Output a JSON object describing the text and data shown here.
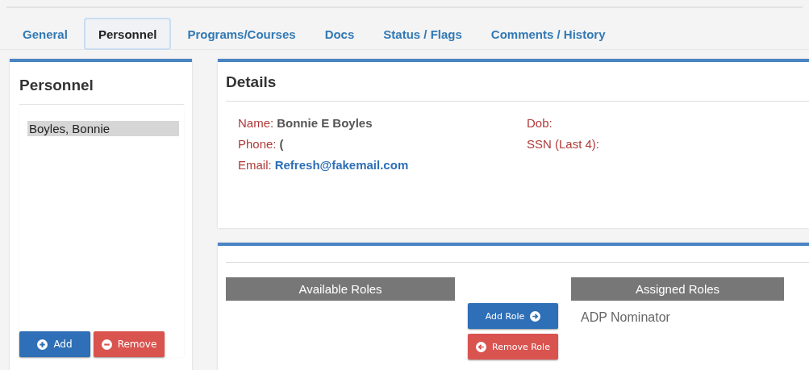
{
  "tabs": [
    {
      "label": "General",
      "selected": false
    },
    {
      "label": "Personnel",
      "selected": true
    },
    {
      "label": "Programs/Courses",
      "selected": false
    },
    {
      "label": "Docs",
      "selected": false
    },
    {
      "label": "Status / Flags",
      "selected": false
    },
    {
      "label": "Comments / History",
      "selected": false
    }
  ],
  "personnel": {
    "title": "Personnel",
    "items": [
      {
        "name": "Boyles, Bonnie",
        "selected": true
      }
    ],
    "buttons": [
      {
        "label": "Add",
        "kind": "add"
      },
      {
        "label": "Remove",
        "kind": "remove"
      }
    ]
  },
  "details": {
    "title": "Details",
    "fields": [
      {
        "label": "Name:",
        "value": "Bonnie E Boyles",
        "kind": "text"
      },
      {
        "label": "Dob:"
      },
      {
        "label": "Phone:",
        "value": "(",
        "kind": "text"
      },
      {
        "label": "SSN (Last 4):"
      },
      {
        "label": "Email:",
        "value": "Refresh@fakemail.com",
        "kind": "link"
      }
    ]
  },
  "roles": {
    "available_title": "Available Roles",
    "assigned_title": "Assigned Roles",
    "assigned": [
      "ADP Nominator"
    ],
    "buttons": [
      {
        "label": "Add Role",
        "kind": "add"
      },
      {
        "label": "Remove Role",
        "kind": "remove"
      }
    ]
  }
}
